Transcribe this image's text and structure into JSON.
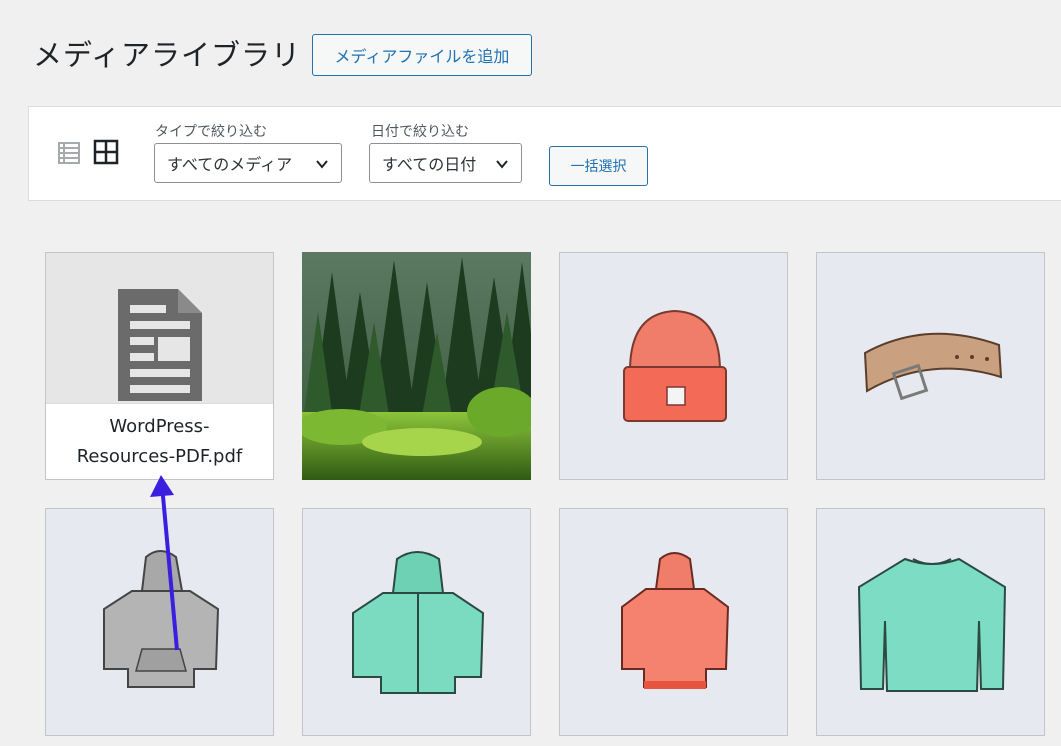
{
  "header": {
    "title": "メディアライブラリ",
    "add_new_label": "メディアファイルを追加"
  },
  "filters": {
    "type_label": "タイプで絞り込む",
    "type_value": "すべてのメディア",
    "date_label": "日付で絞り込む",
    "date_value": "すべての日付",
    "bulk_select_label": "一括選択"
  },
  "view_modes": [
    "list-view-icon",
    "grid-view-icon"
  ],
  "media": {
    "doc": {
      "title_line1": "WordPress-",
      "title_line2": "Resources-PDF.pdf",
      "icon": "document-icon"
    },
    "items": [
      {
        "name": "forest-photo"
      },
      {
        "name": "red-beanie"
      },
      {
        "name": "leather-belt"
      },
      {
        "name": "gray-hoodie"
      },
      {
        "name": "teal-zip-hoodie"
      },
      {
        "name": "red-hoodie"
      },
      {
        "name": "teal-long-sleeve"
      }
    ]
  },
  "colors": {
    "accent": "#2271b1",
    "arrow": "#3b1fe0",
    "tile_bg": "#e6e9ef"
  }
}
